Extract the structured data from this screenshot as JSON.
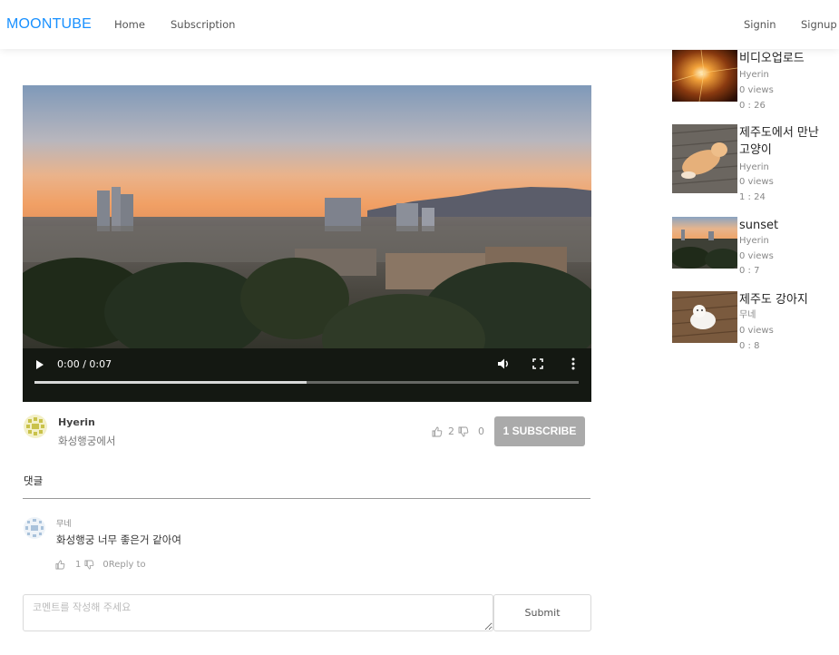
{
  "header": {
    "logo": "MOONTUBE",
    "nav": {
      "home": "Home",
      "subscription": "Subscription"
    },
    "auth": {
      "signin": "Signin",
      "signup": "Signup"
    }
  },
  "video": {
    "time": "0:00 / 0:07",
    "buffered_fraction": 0.5
  },
  "author": {
    "name": "Hyerin",
    "description": "화성행궁에서"
  },
  "reactions": {
    "likes": "2",
    "dislikes": "0"
  },
  "subscribe_label": "1 SUBSCRIBE",
  "comments": {
    "title": "댓글",
    "items": [
      {
        "author": "무네",
        "text": "화성행궁 너무 좋은거 같아여",
        "likes": "1",
        "dislikes": "0",
        "reply_label": "Reply to"
      }
    ],
    "placeholder": "코멘트를 작성해 주세요",
    "submit_label": "Submit"
  },
  "sidebar": [
    {
      "title": "비디오업로드",
      "author": "Hyerin",
      "views": "0 views",
      "duration": "0 : 26"
    },
    {
      "title": "제주도에서 만난 고양이",
      "author": "Hyerin",
      "views": "0 views",
      "duration": "1 : 24"
    },
    {
      "title": "sunset",
      "author": "Hyerin",
      "views": "0 views",
      "duration": "0 : 7"
    },
    {
      "title": "제주도 강아지",
      "author": "무네",
      "views": "0 views",
      "duration": "0 : 8"
    }
  ],
  "colors": {
    "accent": "#1890ff",
    "subscribe_bg": "#aaaaaa"
  }
}
